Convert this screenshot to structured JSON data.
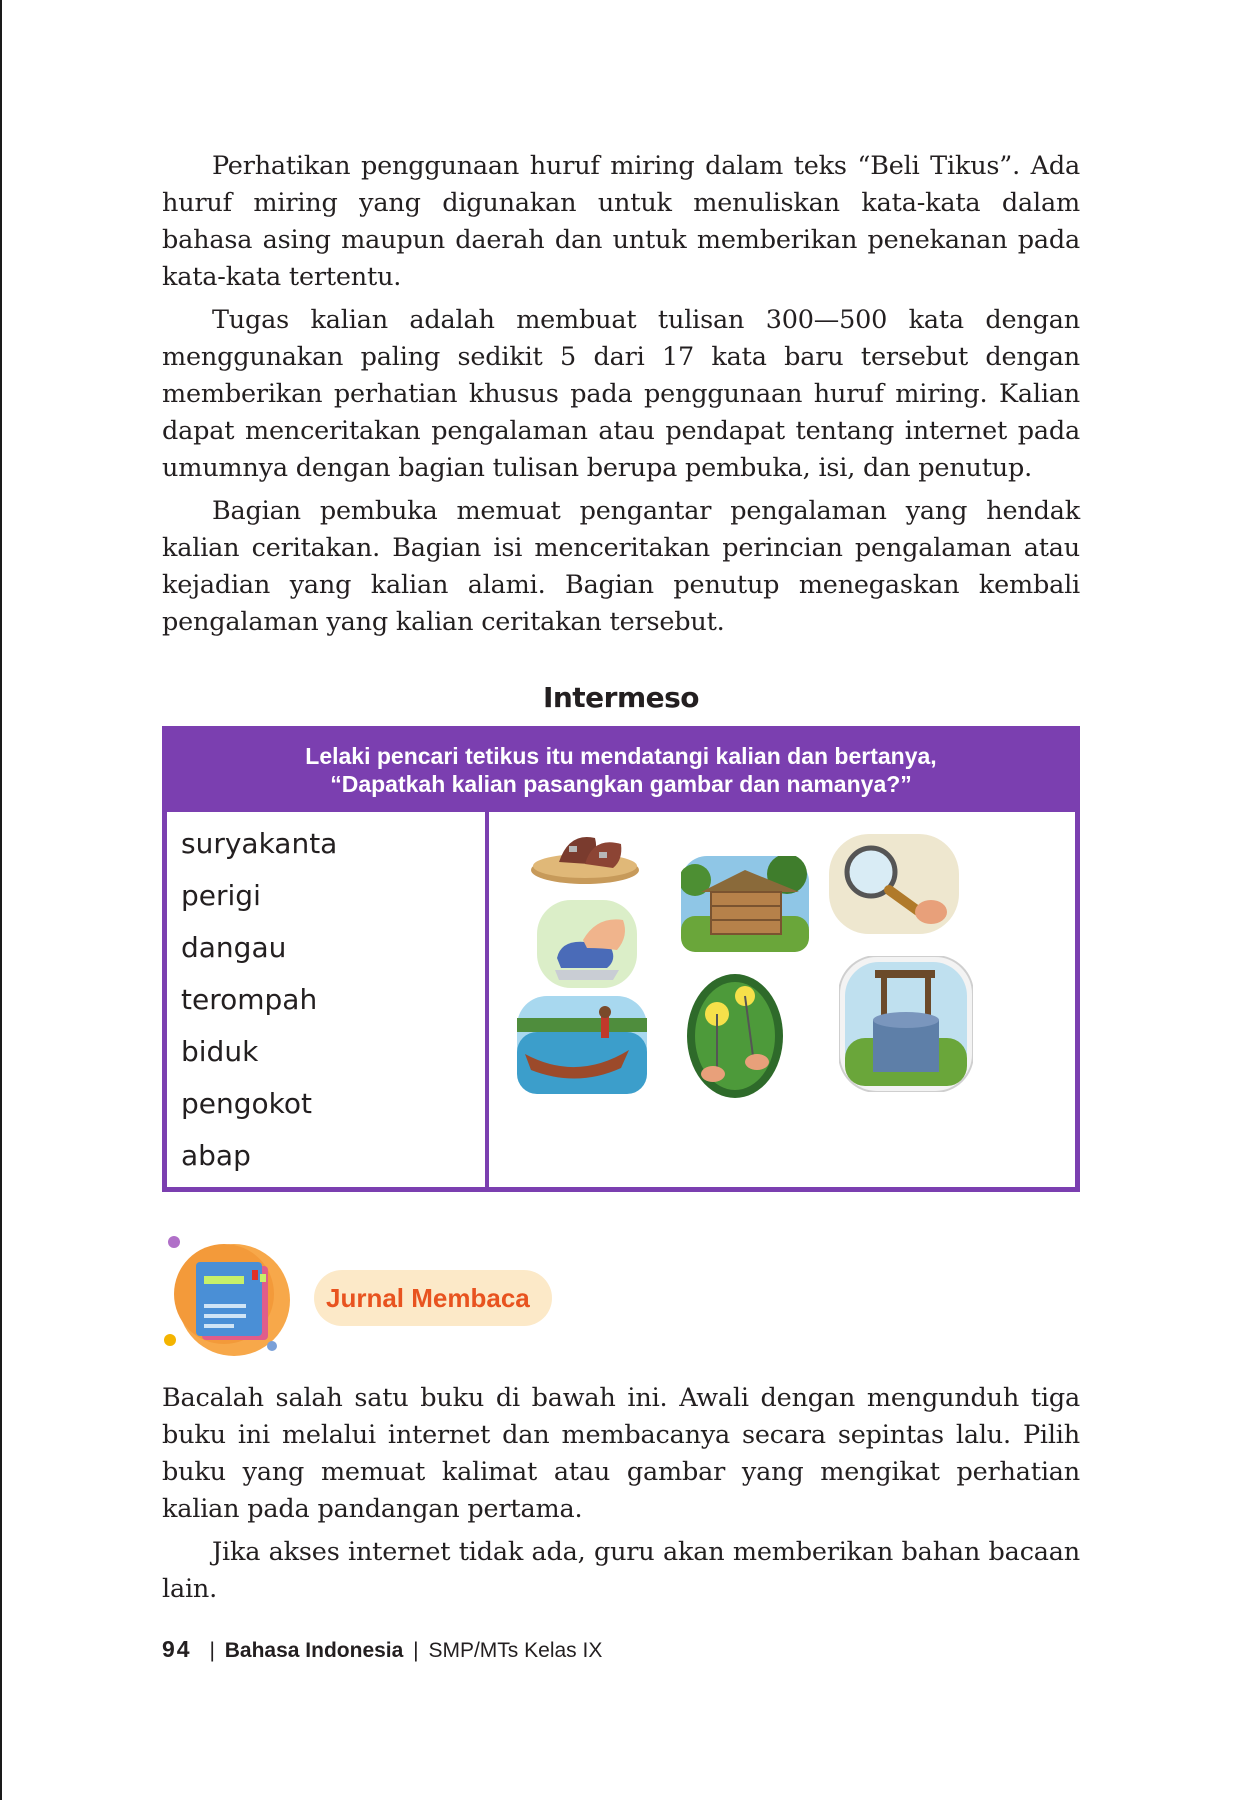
{
  "paragraphs": [
    "Perhatikan penggunaan huruf miring dalam teks “Beli Tikus”. Ada huruf miring yang digunakan untuk menuliskan kata-kata dalam bahasa asing maupun daerah dan untuk memberikan penekanan pada kata-kata tertentu.",
    "Tugas kalian adalah membuat tulisan 300—500 kata dengan menggunakan paling sedikit 5 dari 17 kata baru tersebut dengan memberikan perhatian khusus pada penggunaan huruf miring. Kalian dapat menceritakan pengalaman atau pendapat tentang internet pada umumnya dengan bagian tulisan berupa pembuka, isi, dan penutup.",
    "Bagian pembuka memuat pengantar pengalaman yang hendak kalian ceritakan. Bagian isi menceritakan perincian pengalaman atau kejadian yang kalian alami. Bagian penutup menegaskan kembali pengalaman yang kalian ceritakan tersebut."
  ],
  "intermeso": {
    "title": "Intermeso",
    "prompt_line1": "Lelaki pencari tetikus itu mendatangi kalian dan bertanya,",
    "prompt_line2": "“Dapatkah kalian pasangkan gambar dan namanya?”",
    "words": [
      "suryakanta",
      "perigi",
      "dangau",
      "terompah",
      "biduk",
      "pengokot",
      "abap"
    ],
    "pictures": [
      "sandal-picture",
      "hut-picture",
      "magnifier-picture",
      "stapler-picture",
      "boat-picture",
      "sparkler-picture",
      "well-picture"
    ]
  },
  "jurnal": {
    "label": "Jurnal Membaca",
    "icon": "book-icon"
  },
  "jurnal_paragraphs": [
    "Bacalah salah satu buku di bawah ini. Awali dengan mengunduh tiga buku ini melalui internet dan membacanya secara sepintas lalu. Pilih buku yang memuat kalimat atau gambar yang mengikat perhatian kalian pada pandangan pertama.",
    "Jika akses internet tidak ada, guru akan memberikan bahan bacaan lain."
  ],
  "footer": {
    "page_number": "94",
    "separator": "|",
    "book_title": "Bahasa Indonesia",
    "level": "SMP/MTs Kelas IX"
  },
  "colors": {
    "accent_purple": "#7b3fb0",
    "jurnal_orange": "#e8531f",
    "jurnal_pill": "#fce9c8"
  }
}
